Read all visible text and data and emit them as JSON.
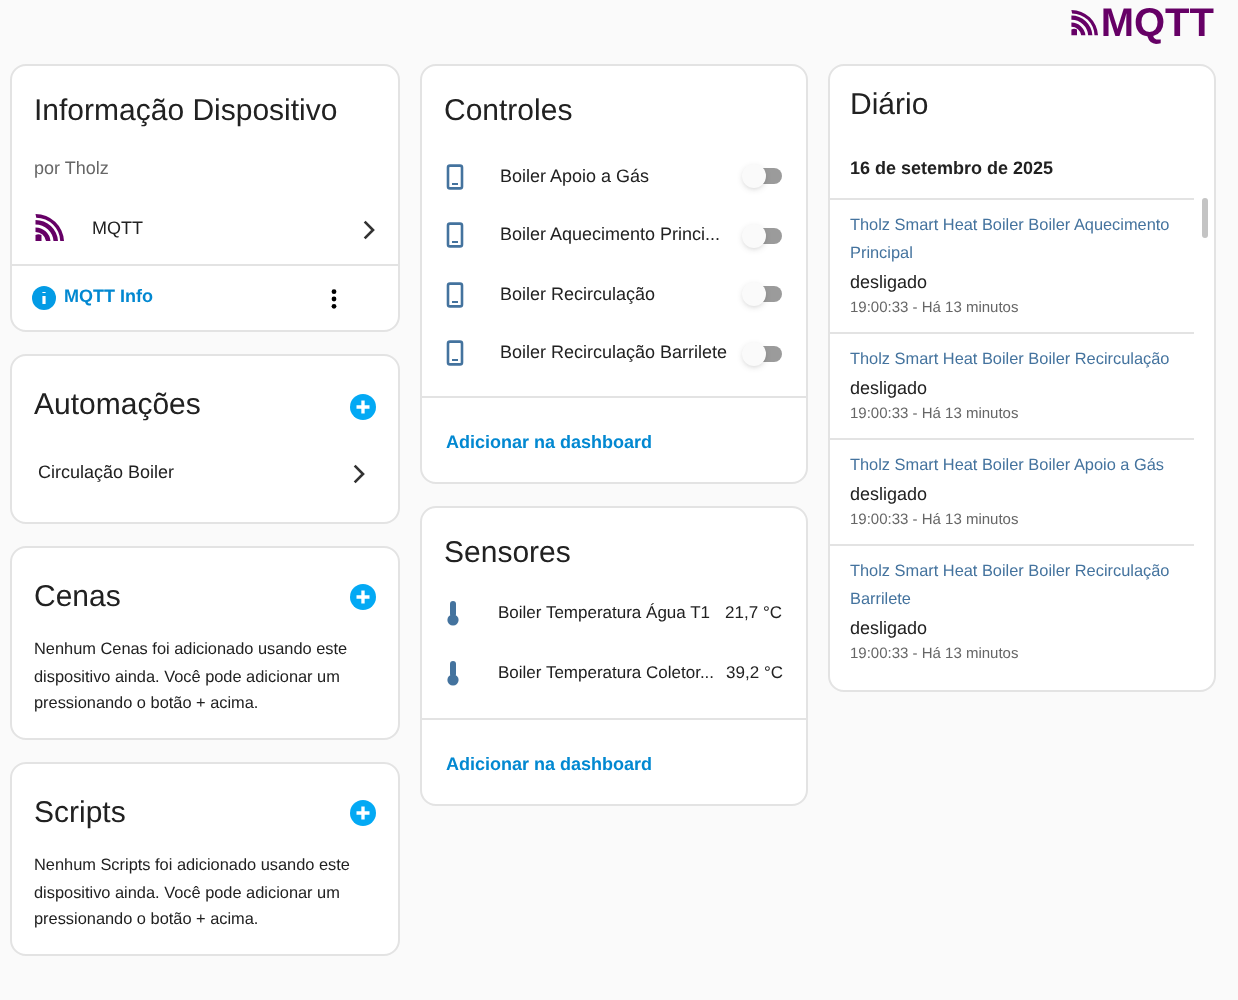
{
  "logo": {
    "text": "MQTT"
  },
  "device_info": {
    "title": "Informação Dispositivo",
    "manufacturer": "por Tholz",
    "integration": "MQTT",
    "link": "MQTT Info"
  },
  "automations": {
    "title": "Automações",
    "items": [
      "Circulação Boiler"
    ]
  },
  "scenes": {
    "title": "Cenas",
    "message": "Nenhum Cenas foi adicionado usando este dispositivo ainda. Você pode adicionar um pressionando o botão + acima."
  },
  "scripts": {
    "title": "Scripts",
    "message": "Nenhum Scripts foi adicionado usando este dispositivo ainda. Você pode adicionar um pressionando o botão + acima."
  },
  "controls": {
    "title": "Controles",
    "items": [
      {
        "name": "Boiler Apoio a Gás",
        "on": false
      },
      {
        "name": "Boiler Aquecimento Princi...",
        "on": false
      },
      {
        "name": "Boiler Recirculação",
        "on": false
      },
      {
        "name": "Boiler Recirculação Barrilete",
        "on": false
      }
    ],
    "action": "Adicionar na dashboard"
  },
  "sensors": {
    "title": "Sensores",
    "items": [
      {
        "name": "Boiler Temperatura Água T1",
        "value": "21,7 °C"
      },
      {
        "name": "Boiler Temperatura Coletor...",
        "value": "39,2 °C"
      }
    ],
    "action": "Adicionar na dashboard"
  },
  "logbook": {
    "title": "Diário",
    "date": "16 de setembro de 2025",
    "entries": [
      {
        "entity": "Tholz Smart Heat Boiler Boiler Aquecimento Principal",
        "state": "desligado",
        "time": "19:00:33 - Há 13 minutos"
      },
      {
        "entity": "Tholz Smart Heat Boiler Boiler Recirculação",
        "state": "desligado",
        "time": "19:00:33 - Há 13 minutos"
      },
      {
        "entity": "Tholz Smart Heat Boiler Boiler Apoio a Gás",
        "state": "desligado",
        "time": "19:00:33 - Há 13 minutos"
      },
      {
        "entity": "Tholz Smart Heat Boiler Boiler Recirculação Barrilete",
        "state": "desligado",
        "time": "19:00:33 - Há 13 minutos"
      }
    ]
  }
}
